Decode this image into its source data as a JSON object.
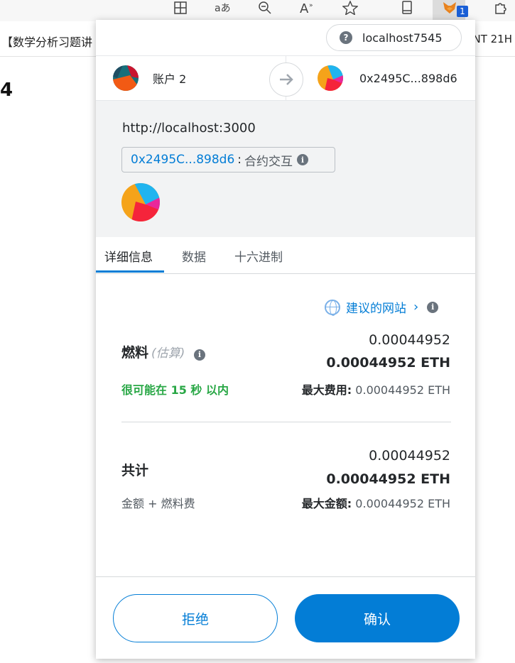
{
  "browser": {
    "toolbar_icons": [
      "tab-grid-icon",
      "read-aloud-icon",
      "zoom-out-icon",
      "text-size-icon",
      "favorite-star-icon",
      "reading-list-icon",
      "metamask-fox-icon",
      "extensions-puzzle-icon"
    ],
    "extension_badge": "1",
    "bookmark_left": "【数学分析习题讲",
    "bookmark_right": "NT 21H",
    "page_fragment": "4"
  },
  "popup": {
    "network": "localhost7545",
    "from_account": "账户 2",
    "to_address": "0x2495C...898d6",
    "origin": "http://localhost:3000",
    "contract_address": "0x2495C...898d6",
    "contract_separator": ":",
    "contract_method": "合约交互",
    "tabs": [
      {
        "label": "详细信息",
        "active": true
      },
      {
        "label": "数据",
        "active": false
      },
      {
        "label": "十六进制",
        "active": false
      }
    ],
    "suggested_site": "建议的网站",
    "gas": {
      "title": "燃料",
      "estimate_label": "(估算)",
      "value": "0.00044952",
      "value_eth": "0.00044952 ETH",
      "timing": "很可能在 15 秒 以内",
      "max_fee_label": "最大费用:",
      "max_fee_value": "0.00044952 ETH"
    },
    "total": {
      "title": "共计",
      "value": "0.00044952",
      "value_eth": "0.00044952 ETH",
      "subtitle": "金额 + 燃料费",
      "max_amount_label": "最大金额:",
      "max_amount_value": "0.00044952 ETH"
    },
    "buttons": {
      "reject": "拒绝",
      "confirm": "确认"
    },
    "colors": {
      "accent": "#037dd6",
      "success": "#28a745"
    }
  }
}
